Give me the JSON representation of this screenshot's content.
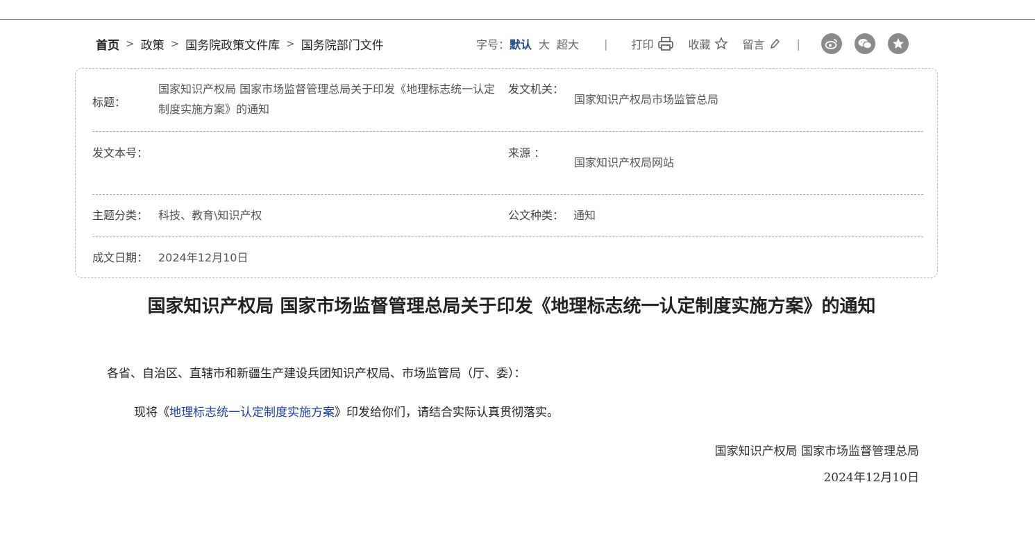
{
  "breadcrumb": {
    "items": [
      "首页",
      "政策",
      "国务院政策文件库",
      "国务院部门文件"
    ],
    "separator": ">"
  },
  "tools": {
    "font_size_label": "字号：",
    "font_sizes": [
      "默认",
      "大",
      "超大"
    ],
    "print_label": "打印",
    "favorite_label": "收藏",
    "comment_label": "留言",
    "divider": "|"
  },
  "info": {
    "title_label": "标题：",
    "title_value": "国家知识产权局 国家市场监督管理总局关于印发《地理标志统一认定制度实施方案》的通知",
    "issuer_label": "发文机关：",
    "issuer_value": "国家知识产权局市场监管总局",
    "doc_no_label": "发文本号：",
    "doc_no_value": "",
    "source_label": "来源 ：",
    "source_value": "国家知识产权局网站",
    "topic_label": "主题分类：",
    "topic_value": "科技、教育\\知识产权",
    "doc_type_label": "公文种类：",
    "doc_type_value": "通知",
    "date_label": "成文日期：",
    "date_value": "2024年12月10日"
  },
  "article": {
    "title": "国家知识产权局 国家市场监督管理总局关于印发《地理标志统一认定制度实施方案》的通知",
    "salutation": "各省、自治区、直辖市和新疆生产建设兵团知识产权局、市场监管局（厅、委）：",
    "body_prefix": "现将《",
    "body_link": "地理标志统一认定制度实施方案",
    "body_suffix": "》印发给你们，请结合实际认真贯彻落实。",
    "signature": "国家知识产权局 国家市场监督管理总局",
    "date": "2024年12月10日"
  },
  "colors": {
    "active_font_size": "#1f4d8c",
    "link": "#1d3fa6",
    "social_icon_bg": "#8a8a8a"
  },
  "icons": [
    "printer-icon",
    "star-icon",
    "pencil-icon",
    "weibo-icon",
    "wechat-icon",
    "favorite-star-icon"
  ]
}
